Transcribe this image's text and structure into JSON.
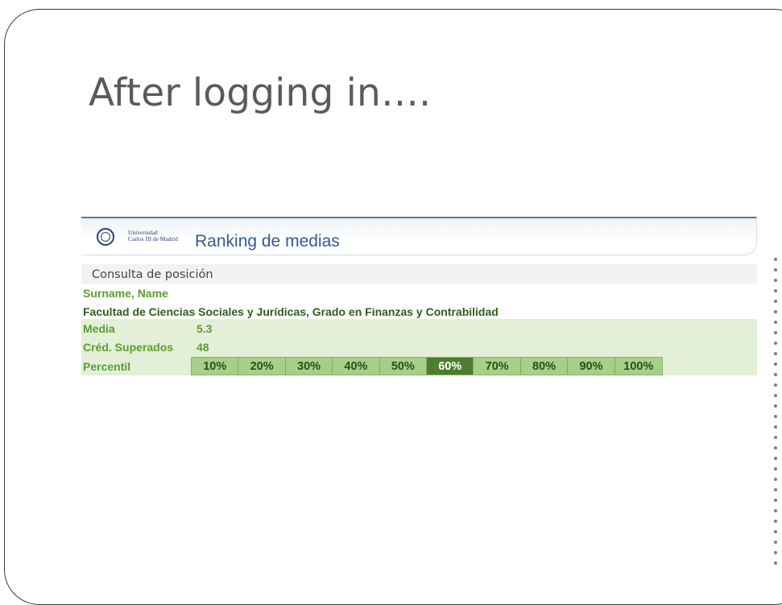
{
  "slide": {
    "title": "After logging in…."
  },
  "app": {
    "logo": {
      "line1": "Universidad",
      "line2": "Carlos III de Madrid"
    },
    "title": "Ranking de medias",
    "section": "Consulta de posición",
    "student_name": "Surname, Name",
    "faculty": "Facultad de Ciencias Sociales y Jurídicas, Grado en Finanzas y Contrabilidad",
    "stats": {
      "media_label": "Media",
      "media_value": "5.3",
      "creditos_label": "Créd. Superados",
      "creditos_value": "48",
      "percentil_label": "Percentil"
    },
    "percentiles": [
      "10%",
      "20%",
      "30%",
      "40%",
      "50%",
      "60%",
      "70%",
      "80%",
      "90%",
      "100%"
    ],
    "selected_percentile": "60%"
  },
  "colors": {
    "brand_blue": "#2f5b95",
    "label_green": "#5a9e2f",
    "band_green": "#e3efd6",
    "cell_green": "#a8cf89",
    "active_green": "#4b7f2d"
  }
}
